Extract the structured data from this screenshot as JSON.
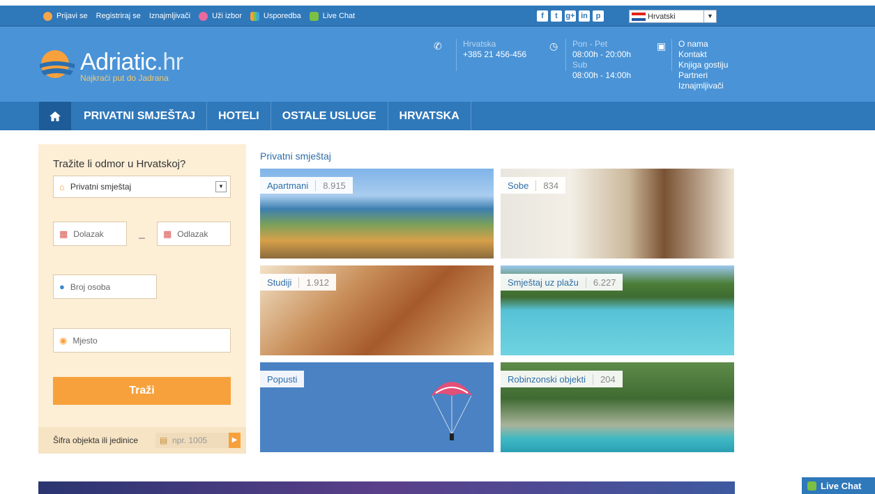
{
  "topbar": {
    "links": [
      {
        "label": "Prijavi se",
        "icon": "user-icon"
      },
      {
        "label": "Registriraj se",
        "icon": ""
      },
      {
        "label": "Iznajmljivači",
        "icon": ""
      },
      {
        "label": "Uži izbor",
        "icon": "heart-icon"
      },
      {
        "label": "Usporedba",
        "icon": "chart-icon"
      },
      {
        "label": "Live Chat",
        "icon": "chat-icon"
      }
    ],
    "social": [
      "f",
      "t",
      "g+",
      "in",
      "p"
    ],
    "language": "Hrvatski"
  },
  "header": {
    "brand": "Adriatic",
    "brand_suffix": ".hr",
    "tagline": "Najkraći put do Jadrana",
    "phone_label": "Hrvatska",
    "phone": "+385 21 456-456",
    "hours1_label": "Pon - Pet",
    "hours1": "08:00h - 20:00h",
    "hours2_label": "Sub",
    "hours2": "08:00h - 14:00h",
    "links": [
      "O nama",
      "Kontakt",
      "Knjiga gostiju",
      "Partneri",
      "Iznajmljivači"
    ]
  },
  "nav": {
    "items": [
      "PRIVATNI SMJEŠTAJ",
      "HOTELI",
      "OSTALE USLUGE",
      "HRVATSKA"
    ]
  },
  "search": {
    "title": "Tražite li odmor u Hrvatskoj?",
    "type_value": "Privatni smještaj",
    "arrival_placeholder": "Dolazak",
    "departure_placeholder": "Odlazak",
    "dash": "–",
    "persons_placeholder": "Broj osoba",
    "place_placeholder": "Mjesto",
    "submit_label": "Traži",
    "code_label": "Šifra objekta ili jedinice",
    "code_placeholder": "npr. 1005"
  },
  "main": {
    "section_title": "Privatni smještaj",
    "tiles": [
      {
        "name": "Apartmani",
        "count": "8.915"
      },
      {
        "name": "Sobe",
        "count": "834"
      },
      {
        "name": "Studiji",
        "count": "1.912"
      },
      {
        "name": "Smještaj uz plažu",
        "count": "6.227"
      },
      {
        "name": "Popusti",
        "count": ""
      },
      {
        "name": "Robinzonski objekti",
        "count": "204"
      }
    ]
  },
  "livechat_label": "Live Chat",
  "colors": {
    "primary": "#2f78ba",
    "header": "#4a93d6",
    "accent": "#f7a13c",
    "panel": "#fdeed6"
  }
}
